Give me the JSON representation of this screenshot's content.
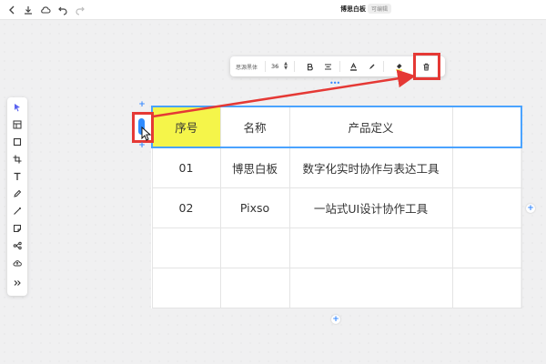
{
  "header": {
    "title": "博思白板",
    "badge": "可编辑",
    "icons": [
      "back-icon",
      "download-icon",
      "cloud-save-icon",
      "undo-icon",
      "redo-icon"
    ]
  },
  "left_toolbar": {
    "tools": [
      "select-tool",
      "frame-tool",
      "shape-tool",
      "crop-tool",
      "text-tool",
      "pen-tool",
      "connector-tool",
      "sticky-note-tool",
      "mindmap-tool",
      "upload-tool",
      "more-tools"
    ]
  },
  "float_toolbar": {
    "font": "思源黑体",
    "size": "36",
    "buttons": [
      "bold-icon",
      "align-center-icon",
      "text-color-icon",
      "highlight-icon",
      "fill-color-icon",
      "delete-icon"
    ],
    "colors": {
      "accent": "#3a8bff",
      "fill_swatch": "#f5f54a"
    }
  },
  "table": {
    "headers": [
      "序号",
      "名称",
      "产品定义",
      ""
    ],
    "rows": [
      [
        "01",
        "博思白板",
        "数字化实时协作与表达工具",
        ""
      ],
      [
        "02",
        "Pixso",
        "一站式UI设计协作工具",
        ""
      ],
      [
        "",
        "",
        "",
        ""
      ],
      [
        "",
        "",
        "",
        ""
      ]
    ],
    "header_fill": "#f5f54a",
    "selection_color": "#4aa3ff"
  },
  "annotations": {
    "highlight_color": "#e53935"
  }
}
